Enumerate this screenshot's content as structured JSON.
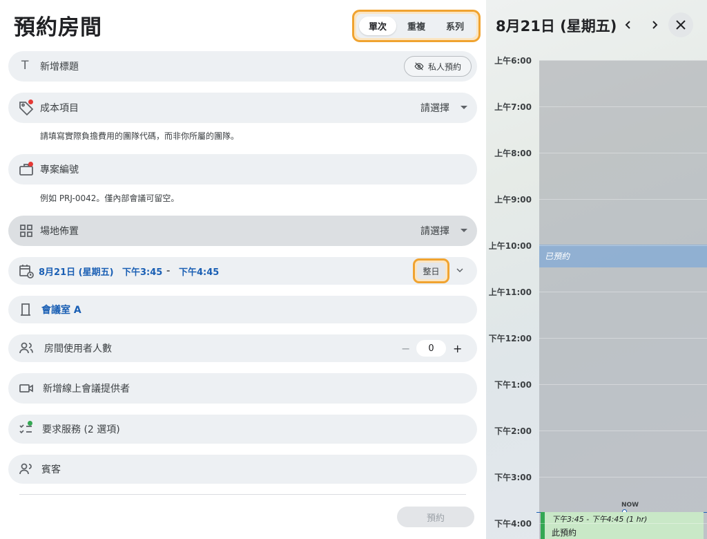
{
  "title": "預約房間",
  "mode_tabs": [
    {
      "label": "單次",
      "active": true
    },
    {
      "label": "重複",
      "active": false
    },
    {
      "label": "系列",
      "active": false
    }
  ],
  "form": {
    "title_placeholder": "新增標題",
    "private_label": "私人預約",
    "cost_item": {
      "label": "成本項目",
      "value": "請選擇",
      "hint": "請填寫實際負擔費用的團隊代碼，而非你所屬的團隊。"
    },
    "project_code": {
      "label": "專案編號",
      "hint": "例如 PRJ-0042。僅內部會議可留空。"
    },
    "layout": {
      "label": "場地佈置",
      "value": "請選擇"
    },
    "datetime": {
      "date": "8月21日 (星期五)",
      "start": "下午3:45",
      "sep": "-",
      "end": "下午4:45",
      "all_day_label": "整日"
    },
    "room": {
      "label": "會議室 A"
    },
    "attendees": {
      "label": "房間使用者人數",
      "value": "0",
      "minus": "−",
      "plus": "+"
    },
    "online": {
      "label": "新增線上會議提供者"
    },
    "services": {
      "label": "要求服務 (2 選項)"
    },
    "guests": {
      "label": "賓客"
    },
    "submit_label": "預約"
  },
  "calendar": {
    "date_title": "8月21日 (星期五)",
    "hours": [
      "上午6:00",
      "上午7:00",
      "上午8:00",
      "上午9:00",
      "上午10:00",
      "上午11:00",
      "下午12:00",
      "下午1:00",
      "下午2:00",
      "下午3:00",
      "下午4:00"
    ],
    "booked_label": "已預約",
    "now_label": "NOW",
    "this_booking": {
      "time": "下午3:45 - 下午4:45 (1 hr)",
      "label": "此預約"
    }
  },
  "colors": {
    "accent": "#1a5fb4",
    "highlight": "#f0a330",
    "required_dot": "#e53935",
    "booking": "#34a853"
  }
}
